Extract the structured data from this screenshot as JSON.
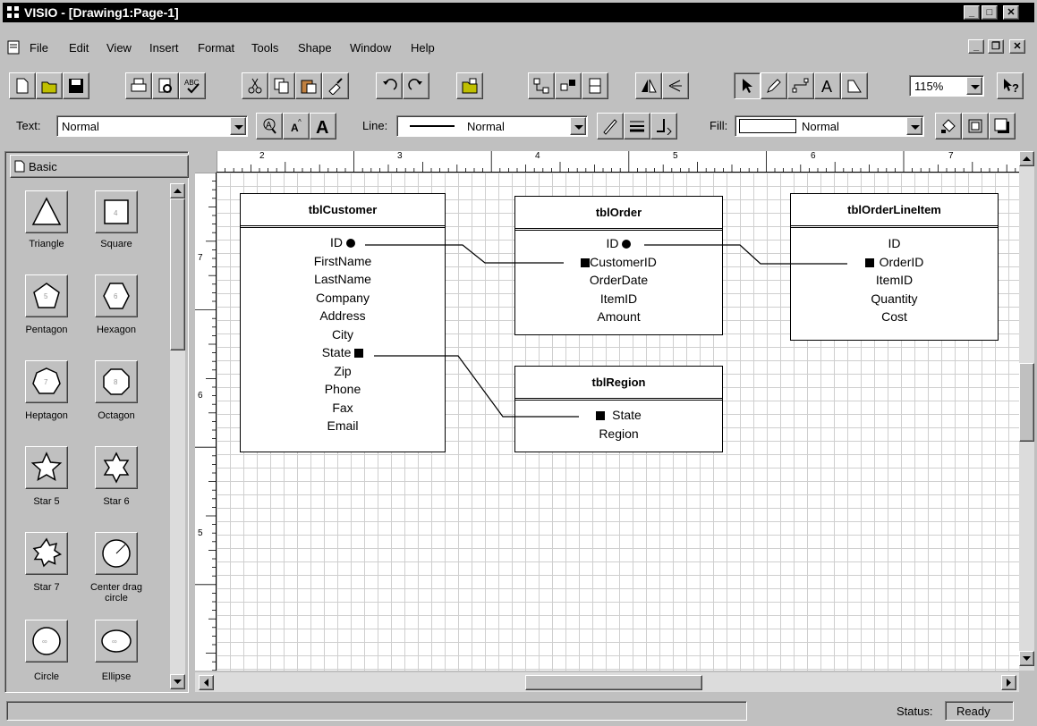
{
  "window": {
    "title": "VISIO - [Drawing1:Page-1]"
  },
  "menu": [
    "File",
    "Edit",
    "View",
    "Insert",
    "Format",
    "Tools",
    "Shape",
    "Window",
    "Help"
  ],
  "toolbar": {
    "zoom": "115%"
  },
  "format_bar": {
    "text_label": "Text:",
    "text_style": "Normal",
    "line_label": "Line:",
    "line_style": "Normal",
    "fill_label": "Fill:",
    "fill_style": "Normal"
  },
  "stencil": {
    "title": "Basic",
    "shapes": [
      "Triangle",
      "Square",
      "Pentagon",
      "Hexagon",
      "Heptagon",
      "Octagon",
      "Star 5",
      "Star 6",
      "Star 7",
      "Center drag circle",
      "Circle",
      "Ellipse"
    ]
  },
  "ruler": {
    "h_marks": [
      "2",
      "3",
      "4",
      "5",
      "6",
      "7"
    ],
    "v_marks": [
      "7",
      "6",
      "5"
    ]
  },
  "tables": [
    {
      "name": "tblCustomer",
      "fields": [
        "ID",
        "FirstName",
        "LastName",
        "Company",
        "Address",
        "City",
        "State",
        "Zip",
        "Phone",
        "Fax",
        "Email"
      ]
    },
    {
      "name": "tblOrder",
      "fields": [
        "ID",
        "CustomerID",
        "OrderDate",
        "ItemID",
        "Amount"
      ]
    },
    {
      "name": "tblOrderLineItem",
      "fields": [
        "ID",
        "OrderID",
        "ItemID",
        "Quantity",
        "Cost"
      ]
    },
    {
      "name": "tblRegion",
      "fields": [
        "State",
        "Region"
      ]
    }
  ],
  "status": {
    "label": "Status:",
    "value": "Ready"
  }
}
